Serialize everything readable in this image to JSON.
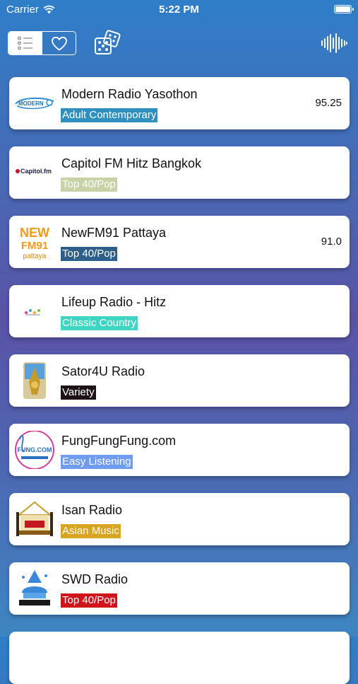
{
  "status_bar": {
    "carrier": "Carrier",
    "time": "5:22 PM"
  },
  "toolbar": {
    "list_icon": "list-icon",
    "favorites_icon": "heart-icon",
    "random_icon": "dice-icon",
    "waveform_icon": "waveform-icon"
  },
  "stations": [
    {
      "name": "Modern Radio Yasothon",
      "genre": "Adult Contemporary",
      "frequency": "95.25",
      "genre_bg": "#2f8fbf",
      "genre_fg": "#ffffff"
    },
    {
      "name": "Capitol FM Hitz Bangkok",
      "genre": "Top 40/Pop",
      "frequency": "",
      "genre_bg": "#c7d3a7",
      "genre_fg": "#ffffff"
    },
    {
      "name": "NewFM91 Pattaya",
      "genre": "Top 40/Pop",
      "frequency": "91.0",
      "genre_bg": "#2e5f8a",
      "genre_fg": "#ffffff"
    },
    {
      "name": "Lifeup Radio - Hitz",
      "genre": "Classic Country",
      "frequency": "",
      "genre_bg": "#3dd6c4",
      "genre_fg": "#ffffff"
    },
    {
      "name": "Sator4U Radio",
      "genre": "Variety",
      "frequency": "",
      "genre_bg": "#1e1418",
      "genre_fg": "#ffffff"
    },
    {
      "name": "FungFungFung.com",
      "genre": "Easy Listening",
      "frequency": "",
      "genre_bg": "#6f9cf0",
      "genre_fg": "#ffffff"
    },
    {
      "name": "Isan Radio",
      "genre": "Asian Music",
      "frequency": "",
      "genre_bg": "#d9a41f",
      "genre_fg": "#ffffff"
    },
    {
      "name": "SWD Radio",
      "genre": "Top 40/Pop",
      "frequency": "",
      "genre_bg": "#d0141c",
      "genre_fg": "#ffffff"
    }
  ],
  "logos": {
    "modern_radio_yasothon": {
      "text": "MODERN"
    },
    "capitol_fm": {
      "text": "Capitol.fm"
    },
    "newfm91": {
      "line1": "NEW",
      "line2": "FM91",
      "line3": "pattaya"
    },
    "fungfungfung": {
      "text": "FUNG.COM"
    },
    "isan_radio": {
      "text": ""
    },
    "swd_radio": {
      "text": ""
    }
  }
}
